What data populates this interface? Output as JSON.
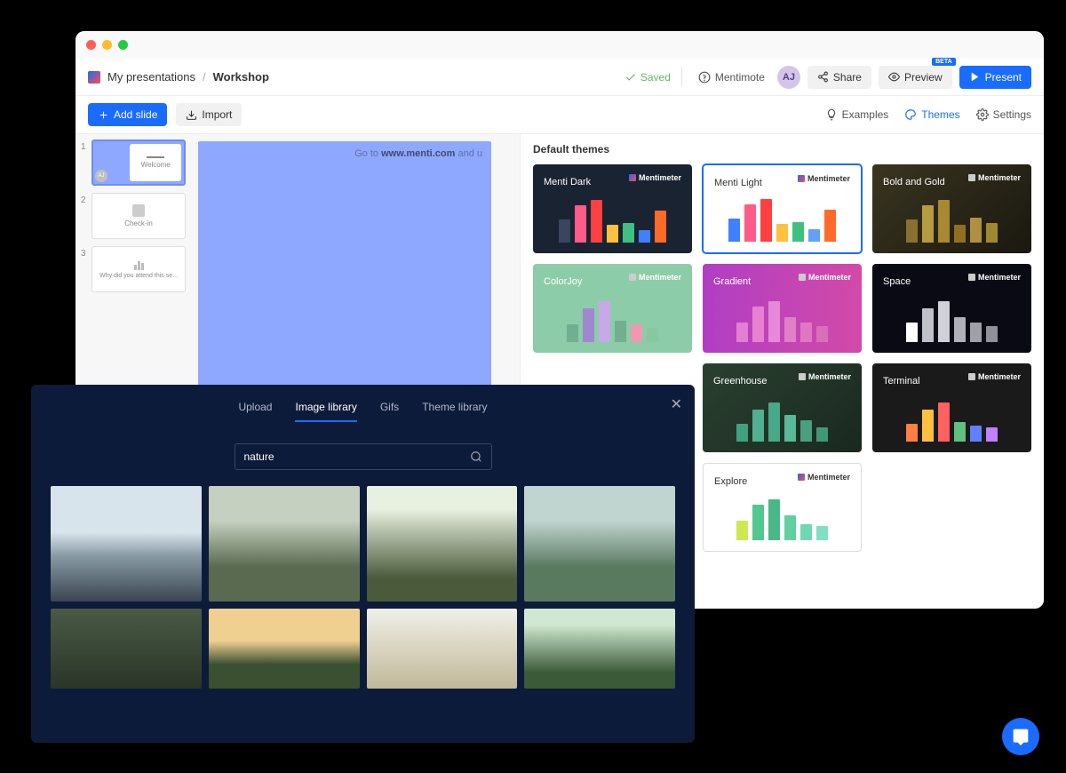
{
  "breadcrumb": {
    "root": "My presentations",
    "current": "Workshop"
  },
  "titlebar": {
    "saved": "Saved",
    "mentimote": "Mentimote",
    "avatar": "AJ",
    "share": "Share",
    "preview": "Preview",
    "beta": "BETA",
    "present": "Present"
  },
  "toolbar": {
    "add_slide": "Add slide",
    "import": "Import",
    "examples": "Examples",
    "themes": "Themes",
    "settings": "Settings"
  },
  "slides": [
    {
      "num": "1",
      "label": "Welcome"
    },
    {
      "num": "2",
      "label": "Check-in"
    },
    {
      "num": "3",
      "label": "Why did you attend this se..."
    }
  ],
  "canvas": {
    "url_prefix": "Go to ",
    "url_host": "www.menti.com",
    "url_suffix": " and u"
  },
  "themes_panel": {
    "title": "Default themes",
    "brand": "Mentimeter",
    "cards": [
      {
        "name": "Menti Dark"
      },
      {
        "name": "Menti Light"
      },
      {
        "name": "Bold and Gold"
      },
      {
        "name": "ColorJoy"
      },
      {
        "name": "Gradient"
      },
      {
        "name": "Space"
      },
      {
        "name": "Greenhouse"
      },
      {
        "name": "Terminal"
      },
      {
        "name": "Explore"
      }
    ]
  },
  "modal": {
    "tabs": [
      "Upload",
      "Image library",
      "Gifs",
      "Theme library"
    ],
    "active_tab": "Image library",
    "search_value": "nature"
  }
}
